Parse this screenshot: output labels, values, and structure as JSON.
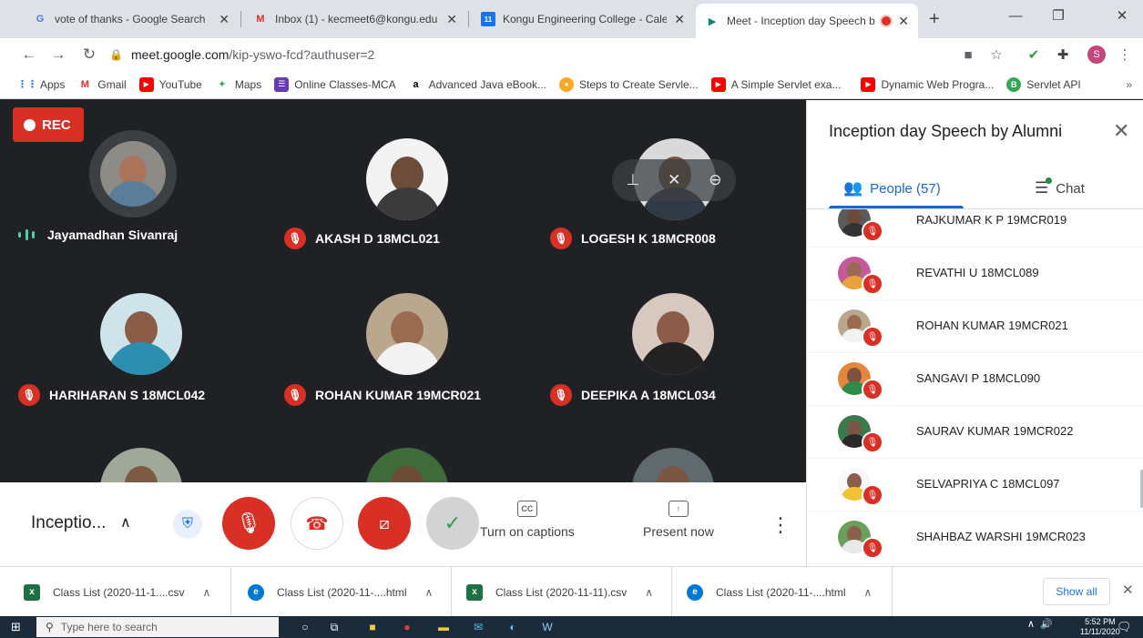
{
  "browser": {
    "tabs": [
      {
        "title": "vote of thanks - Google Search",
        "icon": "google-icon",
        "color": "#4285f4"
      },
      {
        "title": "Inbox (1) - kecmeet6@kongu.edu - ",
        "icon": "gmail-icon",
        "color": "#d93025"
      },
      {
        "title": "Kongu Engineering College - Calend",
        "icon": "calendar-icon",
        "color": "#1a73e8"
      },
      {
        "title": "Meet - Inception day Speech b",
        "icon": "meet-icon",
        "color": "#00897b",
        "active": true
      }
    ],
    "url_host": "meet.google.com",
    "url_path": "/kip-yswo-fcd?authuser=2",
    "profile_initial": "S",
    "bookmarks": [
      {
        "label": "Apps",
        "icon": "apps-grid-icon",
        "color": "#1a73e8"
      },
      {
        "label": "Gmail",
        "icon": "gmail-icon",
        "color": "#d93025"
      },
      {
        "label": "YouTube",
        "icon": "youtube-icon",
        "color": "#ff0000"
      },
      {
        "label": "Maps",
        "icon": "maps-icon",
        "color": "#34a853"
      },
      {
        "label": "Online Classes-MCA",
        "icon": "classes-icon",
        "color": "#673ab7"
      },
      {
        "label": "Advanced Java eBook...",
        "icon": "amazon-icon",
        "color": "#000000"
      },
      {
        "label": "Steps to Create Servle...",
        "icon": "steps-icon",
        "color": "#f9a825"
      },
      {
        "label": "A Simple Servlet exa...",
        "icon": "youtube-icon",
        "color": "#ff0000"
      },
      {
        "label": "Dynamic Web Progra...",
        "icon": "youtube-icon",
        "color": "#ff0000"
      },
      {
        "label": "Servlet API",
        "icon": "servlet-icon",
        "color": "#34a853"
      }
    ],
    "bookmarks_more": "»"
  },
  "meet": {
    "rec_label": "REC",
    "tiles": [
      {
        "name": "Jayamadhan Sivanraj",
        "speaking": true,
        "skin": "#a9745a",
        "shirt": "#5a7d9a",
        "bg": "#8d8b85"
      },
      {
        "name": "AKASH D 18MCL021",
        "muted": true,
        "skin": "#6d4c3a",
        "shirt": "#3b3b3b",
        "bg": "#f3f3f3"
      },
      {
        "name": "LOGESH K 18MCR008",
        "muted": true,
        "skin": "#7a5542",
        "shirt": "#2f3a44",
        "bg": "#d9d9d9"
      },
      {
        "name": "HARIHARAN S 18MCL042",
        "muted": true,
        "skin": "#8a5b45",
        "shirt": "#2c8fb0",
        "bg": "#cfe4ea"
      },
      {
        "name": "ROHAN KUMAR 19MCR021",
        "muted": true,
        "skin": "#9b6b50",
        "shirt": "#f2f2f2",
        "bg": "#b9a78e"
      },
      {
        "name": "DEEPIKA A 18MCL034",
        "muted": true,
        "skin": "#8c5c48",
        "shirt": "#222222",
        "bg": "#d8c9c0"
      }
    ],
    "partial_tiles": [
      {
        "skin": "#7d5a44",
        "bg": "#a0a89a"
      },
      {
        "skin": "#6e4a38",
        "bg": "#3f6b3a"
      },
      {
        "skin": "#7b5644",
        "bg": "#5e6a6e"
      }
    ],
    "meeting_title_short": "Inceptio...",
    "captions_label": "Turn on captions",
    "captions_icon": "CC",
    "present_label": "Present now",
    "panel": {
      "title": "Inception day Speech by Alumni",
      "people_tab": "People (57)",
      "chat_tab": "Chat",
      "people": [
        {
          "name": "RAJKUMAR K P 19MCR019",
          "skin": "#6e4a38",
          "bg": "#5b5b5b"
        },
        {
          "name": "REVATHI U 18MCL089",
          "skin": "#9a6a55",
          "bg": "#c45a9a"
        },
        {
          "name": "ROHAN KUMAR 19MCR021",
          "skin": "#9b6b50",
          "bg": "#b9a78e"
        },
        {
          "name": "SANGAVI P 18MCL090",
          "skin": "#7d5240",
          "bg": "#e5863c"
        },
        {
          "name": "SAURAV KUMAR 19MCR022",
          "skin": "#7a5644",
          "bg": "#3b7a4a"
        },
        {
          "name": "SELVAPRIYA C 18MCL097",
          "skin": "#8a5e48",
          "bg": "#f1c232"
        },
        {
          "name": "SHAHBAZ WARSHI 19MCR023",
          "skin": "#8a6048",
          "bg": "#6a9e5a"
        }
      ]
    }
  },
  "downloads": {
    "items": [
      {
        "name": "Class List (2020-11-1....csv",
        "icon": "csv-file-icon",
        "color": "#1e7145"
      },
      {
        "name": "Class List (2020-11-....html",
        "icon": "edge-icon",
        "color": "#0078d4"
      },
      {
        "name": "Class List (2020-11-11).csv",
        "icon": "csv-file-icon",
        "color": "#1e7145"
      },
      {
        "name": "Class List (2020-11-....html",
        "icon": "edge-icon",
        "color": "#0078d4"
      }
    ],
    "show_all": "Show all"
  },
  "taskbar": {
    "search_placeholder": "Type here to search",
    "time": "5:52 PM",
    "date": "11/11/2020"
  },
  "colors": {
    "mute_red": "#d93025",
    "accent_blue": "#1967d2",
    "meet_dark": "#202124",
    "speaking_wave": "#4dd0a8"
  }
}
